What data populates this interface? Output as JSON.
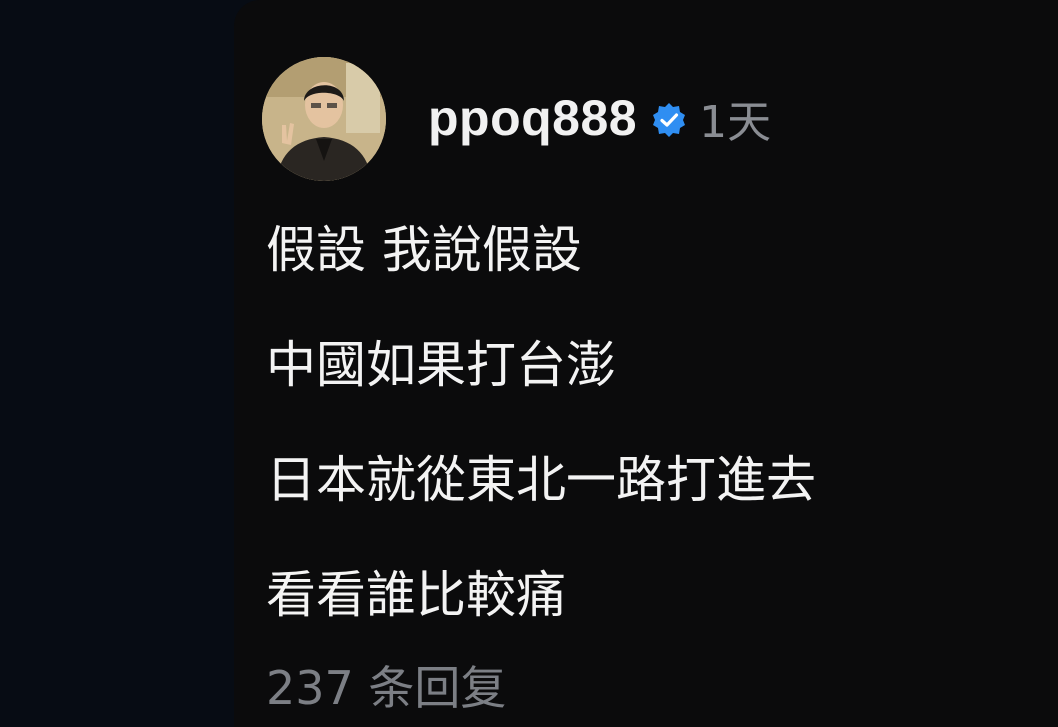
{
  "post": {
    "username": "ppoq888",
    "verified": true,
    "timestamp": "1天",
    "lines": [
      "假設 我說假設",
      "中國如果打台澎",
      "日本就從東北一路打進去",
      "看看誰比較痛"
    ],
    "replies_label": "237 条回复"
  },
  "icons": {
    "avatar": "profile-photo",
    "verified": "verified-badge-icon"
  },
  "colors": {
    "background": "#070c14",
    "card": "#0b0b0c",
    "text_primary": "#f3f3f3",
    "text_secondary": "#8a8d93",
    "verified_badge": "#2f8ef2"
  }
}
